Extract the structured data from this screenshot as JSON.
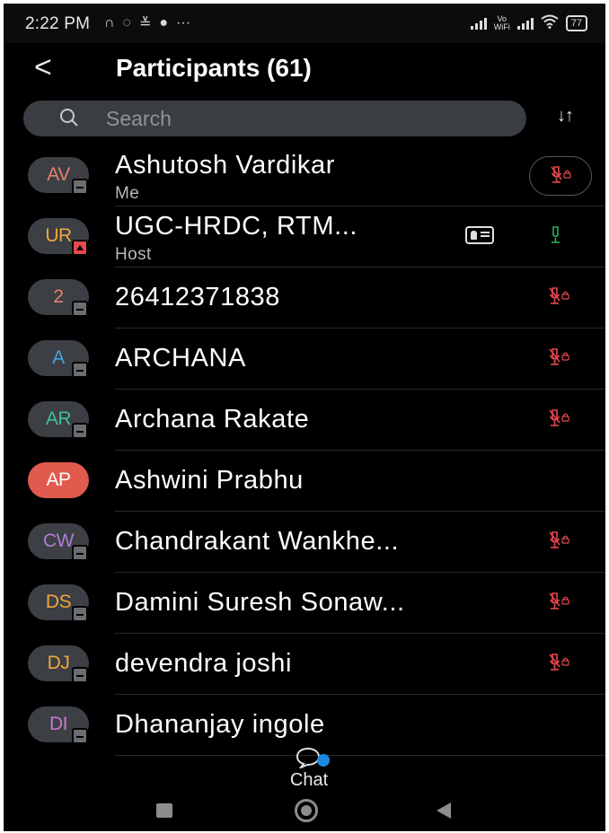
{
  "status_bar": {
    "time": "2:22 PM",
    "left_icons": [
      "headset-icon",
      "whatsapp-icon",
      "signal-disabled-icon",
      "jio-icon",
      "more-dots-icon"
    ],
    "volte": "Vo\nWiFi",
    "battery": "77"
  },
  "header": {
    "back_label": "<",
    "title": "Participants (61)"
  },
  "search": {
    "placeholder": "Search"
  },
  "sort_label": "↓↑",
  "colors": {
    "background": "#000000",
    "search_bg": "#3a3d42",
    "muted_mic": "#e5484d",
    "active_mic": "#22b35e",
    "chat_dot": "#1e88e5"
  },
  "participants": [
    {
      "initials": "AV",
      "color": "#e8836a",
      "name": "Ashutosh Vardikar",
      "sub": "Me",
      "mic": "muted",
      "badge": "phone"
    },
    {
      "initials": "UR",
      "color": "#f0a63a",
      "name": "UGC-HRDC, RTM...",
      "sub": "Host",
      "mic": "active",
      "badge": "upload",
      "card": true
    },
    {
      "initials": "2",
      "color": "#e8836a",
      "name": "26412371838",
      "sub": "",
      "mic": "muted",
      "badge": "phone"
    },
    {
      "initials": "A",
      "color": "#4aa3df",
      "name": "ARCHANA",
      "sub": "",
      "mic": "muted",
      "badge": "phone"
    },
    {
      "initials": "AR",
      "color": "#3fbf9a",
      "name": "Archana Rakate",
      "sub": "",
      "mic": "muted",
      "badge": "phone"
    },
    {
      "initials": "AP",
      "color": "#ffffff",
      "name": "Ashwini Prabhu",
      "sub": "",
      "mic": "none",
      "badge": "none",
      "avatar_bg": "#e05a4e"
    },
    {
      "initials": "CW",
      "color": "#b07cd6",
      "name": "Chandrakant Wankhe...",
      "sub": "",
      "mic": "muted",
      "badge": "phone"
    },
    {
      "initials": "DS",
      "color": "#f0a63a",
      "name": "Damini Suresh Sonaw...",
      "sub": "",
      "mic": "muted",
      "badge": "phone"
    },
    {
      "initials": "DJ",
      "color": "#f0a63a",
      "name": "devendra joshi",
      "sub": "",
      "mic": "muted",
      "badge": "phone"
    },
    {
      "initials": "DI",
      "color": "#c877d0",
      "name": "Dhananjay ingole",
      "sub": "",
      "mic": "none",
      "badge": "phone"
    }
  ],
  "chat": {
    "label": "Chat",
    "unread": true
  }
}
